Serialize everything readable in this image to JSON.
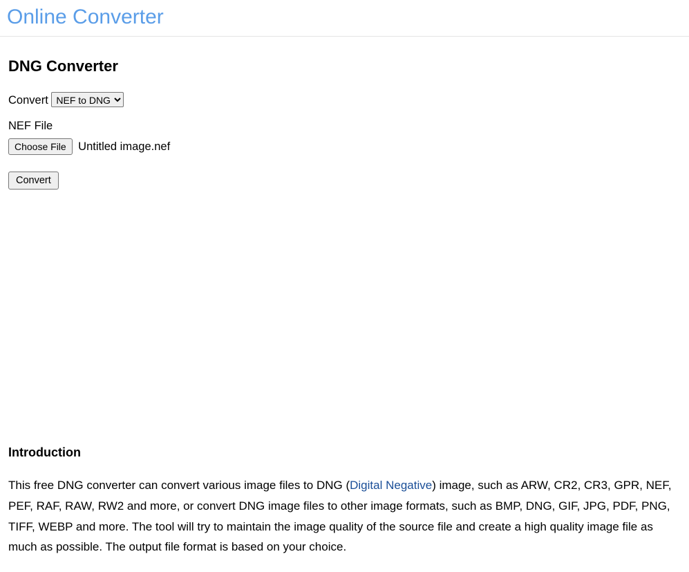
{
  "header": {
    "site_title": "Online Converter"
  },
  "main": {
    "page_title": "DNG Converter",
    "convert_label": "Convert",
    "convert_select_value": "NEF to DNG",
    "file_label": "NEF File",
    "choose_file_label": "Choose File",
    "selected_file_name": "Untitled image.nef",
    "convert_button_label": "Convert"
  },
  "intro": {
    "heading": "Introduction",
    "text_before_link": "This free DNG converter can convert various image files to DNG (",
    "link_text": "Digital Negative",
    "text_after_link": ") image, such as ARW, CR2, CR3, GPR, NEF, PEF, RAF, RAW, RW2 and more, or convert DNG image files to other image formats, such as BMP, DNG, GIF, JPG, PDF, PNG, TIFF, WEBP and more. The tool will try to maintain the image quality of the source file and create a high quality image file as much as possible. The output file format is based on your choice."
  }
}
